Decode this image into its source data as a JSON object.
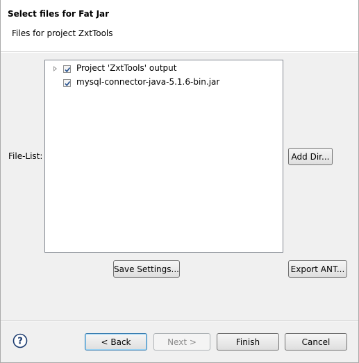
{
  "header": {
    "title": "Select files for Fat Jar",
    "description": "Files for project ZxtTools"
  },
  "filelist": {
    "label": "File-List:",
    "items": [
      {
        "label": "Project 'ZxtTools' output",
        "checked": true,
        "expandable": true
      },
      {
        "label": "mysql-connector-java-5.1.6-bin.jar",
        "checked": true,
        "expandable": false
      }
    ]
  },
  "buttons": {
    "add_dir": "Add Dir...",
    "save_settings": "Save Settings...",
    "export_ant": "Export ANT...",
    "back": "< Back",
    "next": "Next >",
    "finish": "Finish",
    "cancel": "Cancel"
  },
  "icons": {
    "help": "help-icon",
    "expand": "chevron-right-icon",
    "checkbox": "checkbox-checked-icon"
  },
  "colors": {
    "dialog_bg": "#f0f0f0",
    "header_bg": "#ffffff",
    "default_button_border": "#3c7fb1",
    "help_icon": "#1a3a6e"
  }
}
